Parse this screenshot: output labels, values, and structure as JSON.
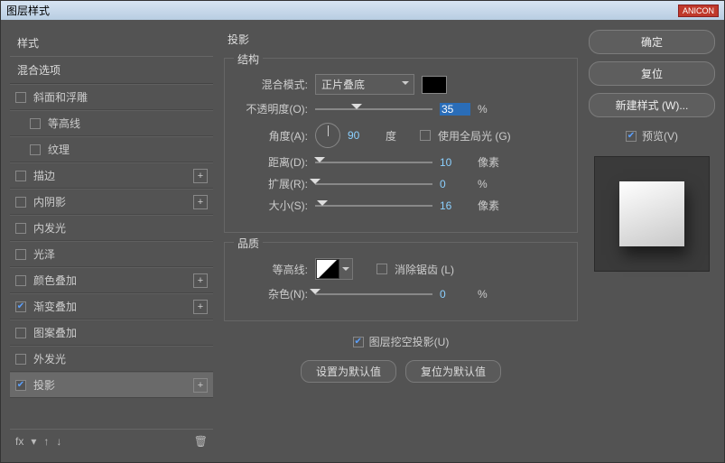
{
  "window": {
    "title": "图层样式",
    "badge": "ANICON"
  },
  "sidebar": {
    "header": "样式",
    "blendOptions": "混合选项",
    "items": [
      {
        "label": "斜面和浮雕",
        "checked": false,
        "indent": false,
        "plus": false
      },
      {
        "label": "等高线",
        "checked": false,
        "indent": true,
        "plus": false
      },
      {
        "label": "纹理",
        "checked": false,
        "indent": true,
        "plus": false
      },
      {
        "label": "描边",
        "checked": false,
        "indent": false,
        "plus": true
      },
      {
        "label": "内阴影",
        "checked": false,
        "indent": false,
        "plus": true
      },
      {
        "label": "内发光",
        "checked": false,
        "indent": false,
        "plus": false
      },
      {
        "label": "光泽",
        "checked": false,
        "indent": false,
        "plus": false
      },
      {
        "label": "颜色叠加",
        "checked": false,
        "indent": false,
        "plus": true
      },
      {
        "label": "渐变叠加",
        "checked": true,
        "indent": false,
        "plus": true
      },
      {
        "label": "图案叠加",
        "checked": false,
        "indent": false,
        "plus": false
      },
      {
        "label": "外发光",
        "checked": false,
        "indent": false,
        "plus": false
      },
      {
        "label": "投影",
        "checked": true,
        "indent": false,
        "plus": true,
        "selected": true
      }
    ],
    "footer": {
      "fx": "fx"
    }
  },
  "main": {
    "title": "投影",
    "structure": {
      "legend": "结构",
      "blendModeLabel": "混合模式:",
      "blendModeValue": "正片叠底",
      "opacityLabel": "不透明度(O):",
      "opacityValue": "35",
      "opacityUnit": "%",
      "angleLabel": "角度(A):",
      "angleValue": "90",
      "angleUnit": "度",
      "globalLightLabel": "使用全局光 (G)",
      "distanceLabel": "距离(D):",
      "distanceValue": "10",
      "distanceUnit": "像素",
      "spreadLabel": "扩展(R):",
      "spreadValue": "0",
      "spreadUnit": "%",
      "sizeLabel": "大小(S):",
      "sizeValue": "16",
      "sizeUnit": "像素"
    },
    "quality": {
      "legend": "品质",
      "contourLabel": "等高线:",
      "antiAliasLabel": "消除锯齿 (L)",
      "noiseLabel": "杂色(N):",
      "noiseValue": "0",
      "noiseUnit": "%"
    },
    "knockoutLabel": "图层挖空投影(U)",
    "setDefault": "设置为默认值",
    "resetDefault": "复位为默认值"
  },
  "right": {
    "ok": "确定",
    "reset": "复位",
    "newStyle": "新建样式 (W)...",
    "previewLabel": "预览(V)"
  }
}
